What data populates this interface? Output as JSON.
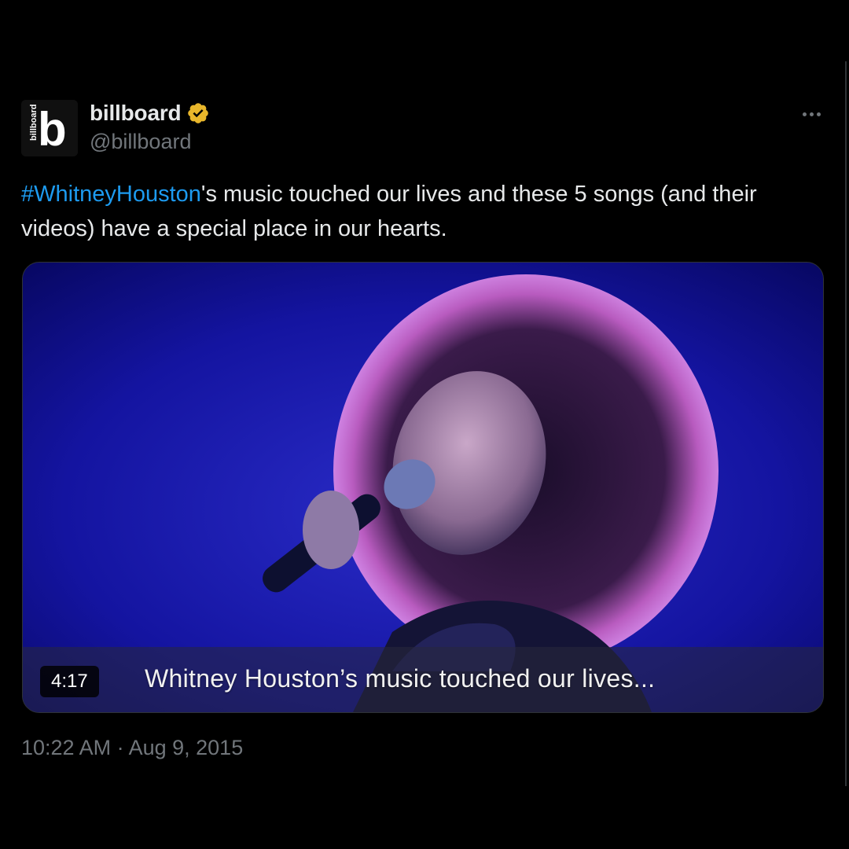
{
  "author": {
    "display_name": "billboard",
    "handle": "@billboard",
    "avatar_wordmark": "billboard",
    "avatar_letter": "b",
    "verified_color": "#e8b62b"
  },
  "tweet": {
    "hashtag": "#WhitneyHouston",
    "text_rest": "'s music touched our lives and these 5 songs (and their videos) have a special place in our hearts.",
    "hashtag_color": "#1d9bf0"
  },
  "media": {
    "duration": "4:17",
    "caption": "Whitney Houston’s music touched our lives..."
  },
  "timestamp": "10:22 AM · Aug 9, 2015",
  "icons": {
    "more": "more-horizontal-icon",
    "verified": "verified-badge-icon"
  }
}
